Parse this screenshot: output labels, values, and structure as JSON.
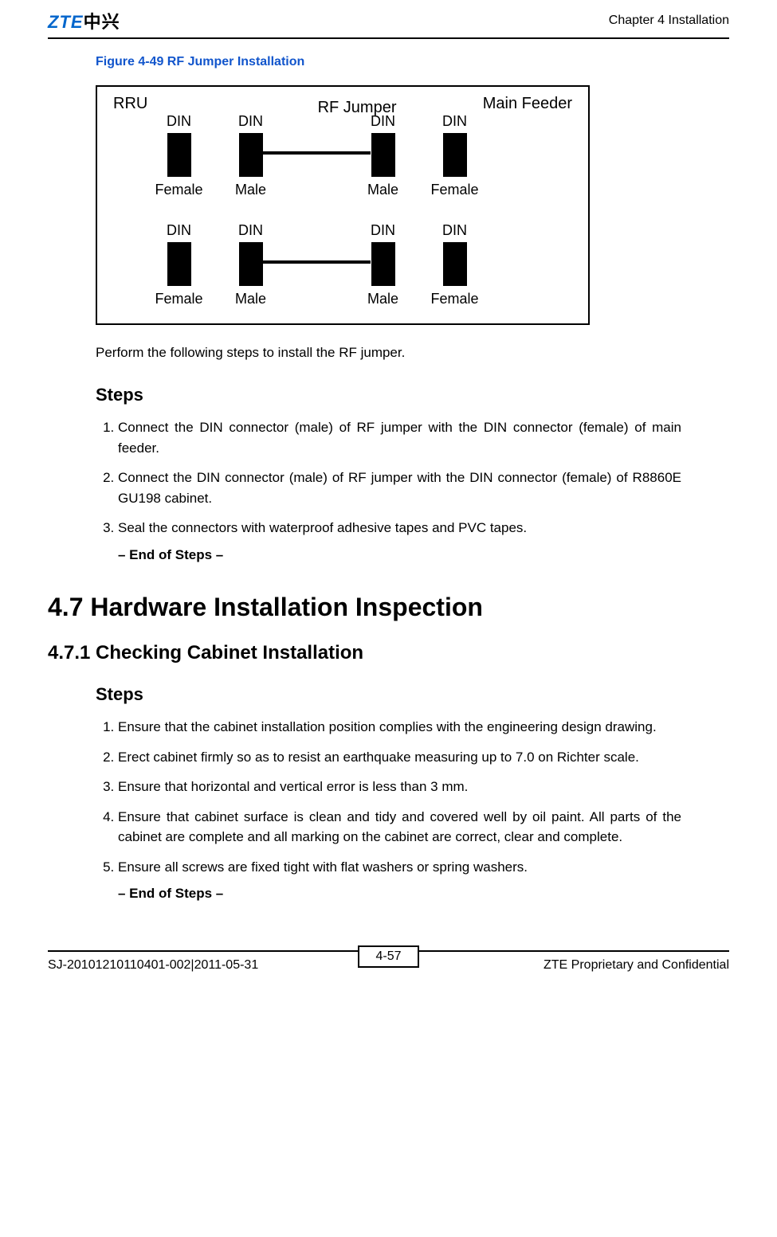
{
  "header": {
    "logo_prefix": "ZTE",
    "logo_cn": "中兴",
    "chapter": "Chapter 4 Installation"
  },
  "figure": {
    "caption": "Figure 4-49 RF Jumper Installation",
    "rru": "RRU",
    "rf_jumper": "RF Jumper",
    "main_feeder": "Main Feeder",
    "din": "DIN",
    "female": "Female",
    "male": "Male"
  },
  "section_rf": {
    "intro": "Perform the following steps to install the RF jumper.",
    "steps_heading": "Steps",
    "steps": [
      "Connect the DIN connector (male) of RF jumper with the DIN connector (female) of main feeder.",
      "Connect the DIN connector (male) of RF jumper with the DIN connector (female) of R8860E GU198 cabinet.",
      "Seal the connectors with waterproof adhesive tapes and PVC tapes."
    ],
    "end": "– End of Steps –"
  },
  "section_47": {
    "heading": "4.7 Hardware Installation Inspection"
  },
  "section_471": {
    "heading": "4.7.1 Checking Cabinet Installation",
    "steps_heading": "Steps",
    "steps": [
      "Ensure that the cabinet installation position complies with the engineering design drawing.",
      "Erect cabinet firmly so as to resist an earthquake measuring up to 7.0 on Richter scale.",
      "Ensure that horizontal and vertical error is less than 3 mm.",
      "Ensure that cabinet surface is clean and tidy and covered well by oil paint. All parts of the cabinet are complete and all marking on the cabinet are correct, clear and complete.",
      "Ensure all screws are fixed tight with flat washers or spring washers."
    ],
    "end": "– End of Steps –"
  },
  "footer": {
    "page": "4-57",
    "doc_id": "SJ-20101210110401-002|2011-05-31",
    "confidential": "ZTE Proprietary and Confidential"
  }
}
